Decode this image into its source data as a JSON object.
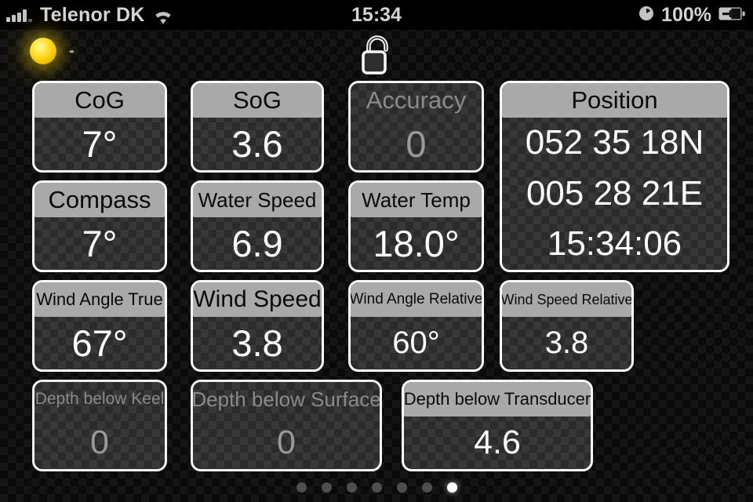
{
  "status_bar": {
    "carrier": "Telenor DK",
    "signal_icon": "signal-bars-icon",
    "wifi_icon": "wifi-icon",
    "time": "15:34",
    "clock_icon": "clock-icon",
    "battery_percent": "100%",
    "battery_icon": "battery-charging-icon"
  },
  "top_bar": {
    "sun_icon": "sun-icon",
    "sun_label": "-",
    "lock_icon": "padlock-open-icon"
  },
  "theme": {
    "header_active_bg": "#a9a9a9",
    "header_active_text": "#0a0a0a",
    "value_active_text": "#ffffff",
    "value_dim_text": "#999999",
    "tile_border": "#fbfbfb",
    "background": "#0a0a0a",
    "sun_color": "#ffe32e"
  },
  "tiles": [
    {
      "id": "cog",
      "label": "CoG",
      "value": "7°",
      "active": true,
      "label_size": 31,
      "value_size": 47
    },
    {
      "id": "sog",
      "label": "SoG",
      "value": "3.6",
      "active": true,
      "label_size": 31,
      "value_size": 47
    },
    {
      "id": "accuracy",
      "label": "Accuracy",
      "value": "0",
      "active": false,
      "label_size": 31,
      "value_size": 47
    },
    {
      "id": "position",
      "label": "Position",
      "value": "",
      "active": true,
      "label_size": 31,
      "value_size": 44,
      "lines": [
        "052 35 18N",
        "005 28 21E",
        "15:34:06"
      ]
    },
    {
      "id": "compass",
      "label": "Compass",
      "value": "7°",
      "active": true,
      "label_size": 31,
      "value_size": 47
    },
    {
      "id": "water-speed",
      "label": "Water Speed",
      "value": "6.9",
      "active": true,
      "label_size": 26,
      "value_size": 47
    },
    {
      "id": "water-temp",
      "label": "Water Temp",
      "value": "18.0°",
      "active": true,
      "label_size": 26,
      "value_size": 47
    },
    {
      "id": "wind-angle-true",
      "label": "Wind Angle True",
      "value": "67°",
      "active": true,
      "label_size": 22,
      "value_size": 47
    },
    {
      "id": "wind-speed",
      "label": "Wind Speed",
      "value": "3.8",
      "active": true,
      "label_size": 30,
      "value_size": 47
    },
    {
      "id": "wind-angle-relative",
      "label": "Wind Angle Relative",
      "value": "60°",
      "active": true,
      "label_size": 19,
      "value_size": 40
    },
    {
      "id": "wind-speed-relative",
      "label": "Wind Speed Relative",
      "value": "3.8",
      "active": true,
      "label_size": 18,
      "value_size": 40
    },
    {
      "id": "depth-below-keel",
      "label": "Depth below Keel",
      "value": "0",
      "active": false,
      "label_size": 21,
      "value_size": 43
    },
    {
      "id": "depth-below-surface",
      "label": "Depth below Surface",
      "value": "0",
      "active": false,
      "label_size": 26,
      "value_size": 43
    },
    {
      "id": "depth-below-transducer",
      "label": "Depth below Transducer",
      "value": "4.6",
      "active": true,
      "label_size": 22,
      "value_size": 43
    }
  ],
  "pagination": {
    "total": 7,
    "active_index": 7
  }
}
